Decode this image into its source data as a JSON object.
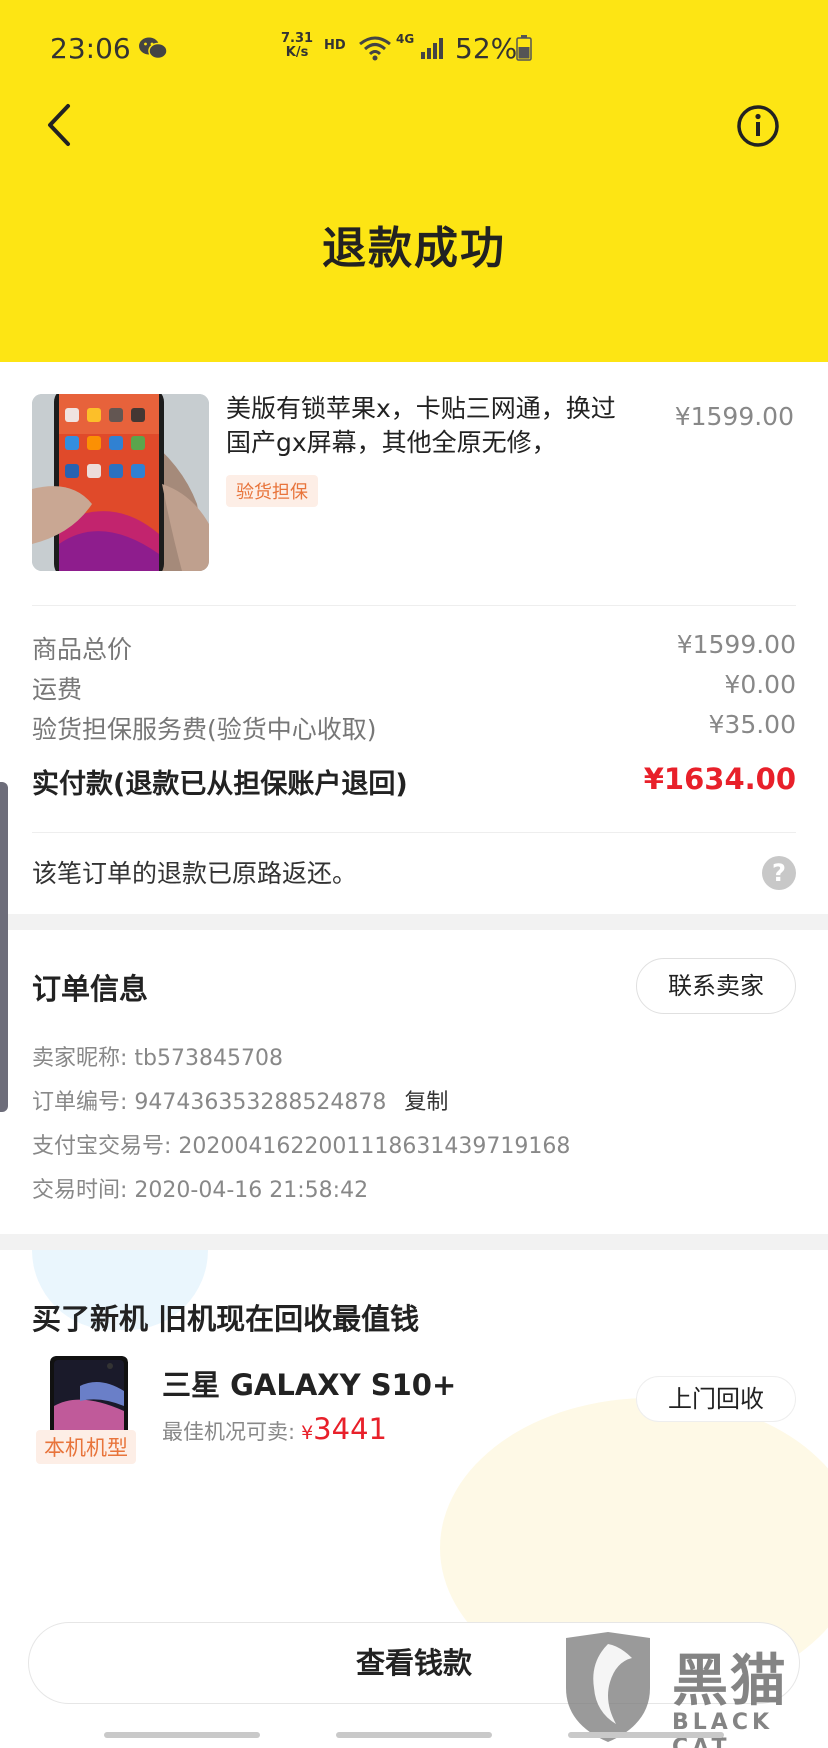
{
  "status_bar": {
    "time": "23:06",
    "net_speed_value": "7.31",
    "net_speed_unit": "K/s",
    "hd": "HD",
    "network": "4G",
    "battery": "52%"
  },
  "header": {
    "title": "退款成功",
    "background": "#FDE514"
  },
  "product": {
    "title": "美版有锁苹果x，卡贴三网通，换过国产gx屏幕，其他全原无修，",
    "price": "¥1599.00",
    "tag": "验货担保"
  },
  "price_rows": [
    {
      "label": "商品总价",
      "value": "¥1599.00"
    },
    {
      "label": "运费",
      "value": "¥0.00"
    },
    {
      "label": "验货担保服务费(验货中心收取)",
      "value": "¥35.00"
    }
  ],
  "total": {
    "label": "实付款(退款已从担保账户退回)",
    "value": "¥1634.00"
  },
  "refund_note": "该笔订单的退款已原路返还。",
  "order_info": {
    "title": "订单信息",
    "contact_button": "联系卖家",
    "seller_label": "卖家昵称: ",
    "seller_value": "tb573845708",
    "order_no_label": "订单编号: ",
    "order_no_value": "947436353288524878",
    "copy_label": "复制",
    "alipay_label": "支付宝交易号: ",
    "alipay_value": "2020041622001118631439719168",
    "time_label": "交易时间: ",
    "time_value": "2020-04-16 21:58:42"
  },
  "recycle": {
    "title": "买了新机 旧机现在回收最值钱",
    "model_tag": "本机机型",
    "model_name": "三星 GALAXY S10+",
    "price_label": "最佳机况可卖:",
    "currency": "¥",
    "price": "3441",
    "button": "上门回收"
  },
  "bottom_button": "查看钱款",
  "watermark": {
    "text": "黑猫",
    "sub": "BLACK CAT"
  },
  "colors": {
    "accent_yellow": "#FDE514",
    "price_red": "#E8202A",
    "tag_orange": "#E8743B"
  }
}
